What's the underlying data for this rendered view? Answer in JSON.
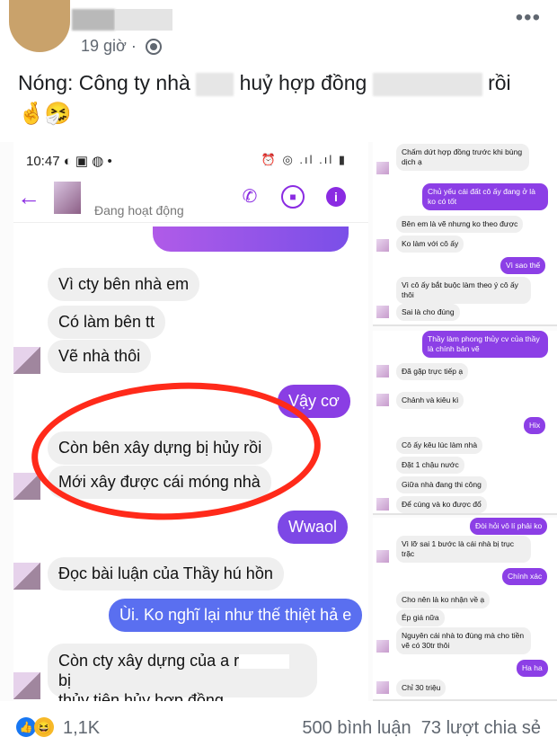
{
  "post": {
    "time": "19 giờ ·",
    "caption_part1": "Nóng: Công ty nhà",
    "caption_part2": "huỷ hợp đồng",
    "caption_part3": "rồi",
    "emojis": "🤞🤧",
    "more_glyph": "•••"
  },
  "phone": {
    "status_time": "10:47 ◐ ▣ ◍ •",
    "status_icons": "⏰ ◎ .ıl .ıl ▮",
    "active_label": "Đang hoạt động",
    "messages": [
      {
        "text": "Vì cty bên nhà em",
        "dir": "in"
      },
      {
        "text": "Có làm bên tt",
        "dir": "in"
      },
      {
        "text": "Vẽ nhà thôi",
        "dir": "in"
      },
      {
        "text": "Vậy cơ",
        "dir": "out"
      },
      {
        "text": "Còn bên xây dựng bị hủy rồi",
        "dir": "in"
      },
      {
        "text": "Mới xây được cái móng nhà",
        "dir": "in"
      },
      {
        "text": "Wwaol",
        "dir": "out"
      },
      {
        "text": "Đọc bài luận của Thầy hú hồn",
        "dir": "in"
      },
      {
        "text": "Ùi. Ko nghĩ lại như thế thiệt hả e",
        "dir": "out"
      },
      {
        "text": "Còn cty xây dựng của a r",
        "dir": "in"
      },
      {
        "text": "bị",
        "dir": "in"
      },
      {
        "text": "thủy tiên hủy hợp đồng",
        "dir": "in"
      }
    ]
  },
  "side1": [
    {
      "text": "Chấm dứt hợp đồng trước khi bùng dịch ạ",
      "dir": "in"
    },
    {
      "text": "Chủ yếu cái đất cô ấy đang ở là ko có tốt",
      "dir": "out"
    },
    {
      "text": "Bên em là vẽ nhưng ko theo được",
      "dir": "in"
    },
    {
      "text": "Ko làm với cô ấy",
      "dir": "in"
    },
    {
      "text": "Vì sao thế",
      "dir": "out"
    },
    {
      "text": "Vì cô ấy bắt buộc làm theo ý cô ấy thôi",
      "dir": "in"
    },
    {
      "text": "Sai là cho đúng",
      "dir": "in"
    }
  ],
  "side2": [
    {
      "text": "Thầy làm phong thủy cv của thầy là chính bản vẽ",
      "dir": "out"
    },
    {
      "text": "Đã gặp trực tiếp ạ",
      "dir": "in"
    },
    {
      "text": "Chảnh và kiêu kì",
      "dir": "in"
    },
    {
      "text": "Hix",
      "dir": "out"
    },
    {
      "text": "Cô ấy kêu lúc làm nhà",
      "dir": "in"
    },
    {
      "text": "Đặt 1 chậu nước",
      "dir": "in"
    },
    {
      "text": "Giữa nhà đang thi công",
      "dir": "in"
    },
    {
      "text": "Để cúng và ko được đổ",
      "dir": "in"
    }
  ],
  "side3": [
    {
      "text": "Đòi hỏi vô lí phải ko",
      "dir": "out"
    },
    {
      "text": "Vì lỡ sai 1 bước là cái nhà bị trục trặc",
      "dir": "in"
    },
    {
      "text": "Chính xác",
      "dir": "out"
    },
    {
      "text": "Cho nên là ko nhận về ạ",
      "dir": "in"
    },
    {
      "text": "Ép giá nữa",
      "dir": "in"
    },
    {
      "text": "Nguyên cái nhà to đùng mà cho tiền vẽ có 30tr thôi",
      "dir": "in"
    },
    {
      "text": "Ha ha",
      "dir": "out"
    },
    {
      "text": "Chỉ 30 triệu",
      "dir": "in"
    }
  ],
  "footer": {
    "reaction_count": "1,1K",
    "comments": "500 bình luận",
    "shares": "73 lượt chia sẻ"
  },
  "colors": {
    "messenger_purple": "#8c3fe6",
    "annotation_red": "#ff2a1a"
  }
}
